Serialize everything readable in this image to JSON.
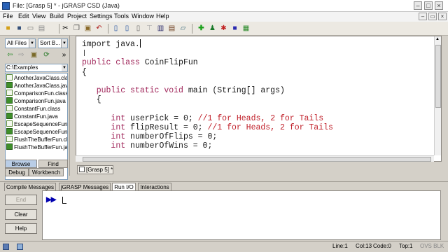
{
  "window": {
    "title": "File: [Grasp 5] * - jGRASP CSD (Java)"
  },
  "menu": [
    "File",
    "Edit",
    "View",
    "Build",
    "Project",
    "Settings",
    "Tools",
    "Window",
    "Help"
  ],
  "left_panel": {
    "filter": "All Files",
    "sort": "Sort B...",
    "path": "C:\\Examples",
    "files": [
      "AnotherJavaClass.class",
      "AnotherJavaClass.java",
      "ComparisonFun.class",
      "ComparisonFun.java",
      "ConstantFun.class",
      "ConstantFun.java",
      "EscapeSequenceFun.class",
      "EscapeSequenceFun.java",
      "FlushTheBufferFun.class",
      "FlushTheBufferFun.java"
    ],
    "tabs": {
      "browse": "Browse",
      "find": "Find",
      "debug": "Debug",
      "workbench": "Workbench"
    }
  },
  "editor": {
    "tab_label": "[Grasp 5] *",
    "lines": {
      "l1": "import java.",
      "l3_kw": "public class",
      "l3_rest": " CoinFlipFun",
      "l4": "{",
      "l6_kw": "public static void",
      "l6_rest": " main (String[] args)",
      "l7": "{",
      "l9_kw": "int",
      "l9_rest": " userPick = 0; ",
      "l9_cm": "//1 for Heads, 2 for Tails",
      "l10_kw": "int",
      "l10_rest": " flipResult = 0; ",
      "l10_cm": "//1 for Heads, 2 for Tails",
      "l11_kw": "int",
      "l11_rest": " numberOfFlips = 0;",
      "l12_kw": "int",
      "l12_rest": " numberOfWins = 0;"
    }
  },
  "bottom_tabs": [
    "Compile Messages",
    "jGRASP Messages",
    "Run I/O",
    "Interactions"
  ],
  "run_buttons": {
    "end": "End",
    "clear": "Clear",
    "help": "Help"
  },
  "console": {
    "prompt": "▶▶"
  },
  "status": {
    "line": "Line:1",
    "col": "Col:13",
    "code": "Code:0",
    "top": "Top:1",
    "mode": "OVS BLK"
  }
}
